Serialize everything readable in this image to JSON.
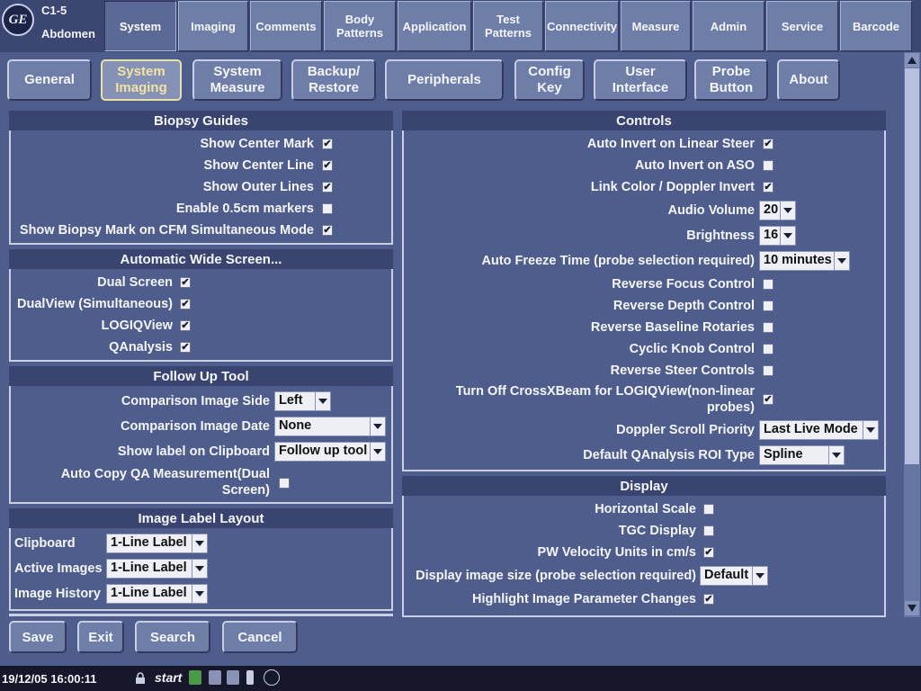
{
  "header": {
    "probe": "C1-5",
    "application": "Abdomen",
    "tabs": [
      {
        "label": "System"
      },
      {
        "label": "Imaging"
      },
      {
        "label": "Comments"
      },
      {
        "label": "Body\nPatterns"
      },
      {
        "label": "Application"
      },
      {
        "label": "Test\nPatterns"
      },
      {
        "label": "Connectivity"
      },
      {
        "label": "Measure"
      },
      {
        "label": "Admin"
      },
      {
        "label": "Service"
      },
      {
        "label": "Barcode"
      }
    ],
    "active_tab": "System"
  },
  "subtabs": [
    {
      "label": "General"
    },
    {
      "label": "System\nImaging"
    },
    {
      "label": "System\nMeasure"
    },
    {
      "label": "Backup/\nRestore"
    },
    {
      "label": "Peripherals"
    },
    {
      "label": "Config\nKey"
    },
    {
      "label": "User\nInterface"
    },
    {
      "label": "Probe\nButton"
    },
    {
      "label": "About"
    }
  ],
  "active_subtab": "System\nImaging",
  "biopsy": {
    "title": "Biopsy Guides",
    "items": [
      {
        "label": "Show Center Mark",
        "checked": true
      },
      {
        "label": "Show Center Line",
        "checked": true
      },
      {
        "label": "Show Outer Lines",
        "checked": true
      },
      {
        "label": "Enable 0.5cm markers",
        "checked": false
      },
      {
        "label": "Show Biopsy Mark on CFM Simultaneous Mode",
        "checked": true
      }
    ]
  },
  "widescreen": {
    "title": "Automatic Wide Screen...",
    "items": [
      {
        "label": "Dual Screen",
        "checked": true
      },
      {
        "label": "DualView (Simultaneous)",
        "checked": true
      },
      {
        "label": "LOGIQView",
        "checked": true
      },
      {
        "label": "QAnalysis",
        "checked": true
      }
    ]
  },
  "followup": {
    "title": "Follow Up Tool",
    "side_label": "Comparison Image Side",
    "side_value": "Left",
    "date_label": "Comparison Image Date",
    "date_value": "None",
    "clipboard_label": "Show label on Clipboard",
    "clipboard_value": "Follow up tool",
    "autocopy_label": "Auto Copy QA Measurement(Dual\nScreen)",
    "autocopy_checked": false
  },
  "labellayout": {
    "title": "Image Label Layout",
    "items": [
      {
        "label": "Clipboard",
        "value": "1-Line Label"
      },
      {
        "label": "Active Images",
        "value": "1-Line Label"
      },
      {
        "label": "Image History",
        "value": "1-Line Label"
      }
    ]
  },
  "controls": {
    "title": "Controls",
    "auto_invert_linear": "Auto Invert on Linear Steer",
    "auto_invert_aso": "Auto Invert on ASO",
    "link_color": "Link Color / Doppler Invert",
    "audio_volume_label": "Audio Volume",
    "audio_volume_value": "20",
    "brightness_label": "Brightness",
    "brightness_value": "16",
    "freeze_label": "Auto Freeze Time (probe selection required)",
    "freeze_value": "10 minutes",
    "reverse_focus": "Reverse Focus Control",
    "reverse_depth": "Reverse Depth Control",
    "reverse_baseline": "Reverse Baseline Rotaries",
    "cyclic_knob": "Cyclic Knob Control",
    "reverse_steer": "Reverse Steer Controls",
    "crossxbeam": "Turn Off CrossXBeam for LOGIQView(non-linear\nprobes)",
    "doppler_scroll_label": "Doppler Scroll Priority",
    "doppler_scroll_value": "Last Live Mode",
    "roi_label": "Default QAnalysis ROI Type",
    "roi_value": "Spline",
    "checks": {
      "auto_invert_linear": true,
      "auto_invert_aso": false,
      "link_color": true,
      "reverse_focus": false,
      "reverse_depth": false,
      "reverse_baseline": false,
      "cyclic_knob": false,
      "reverse_steer": false,
      "crossxbeam": true
    }
  },
  "display": {
    "title": "Display",
    "hscale": "Horizontal Scale",
    "tgc": "TGC Display",
    "pwvel": "PW Velocity Units in cm/s",
    "imgsize_label": "Display image size (probe selection required)",
    "imgsize_value": "Default",
    "highlight": "Highlight Image Parameter Changes",
    "checks": {
      "hscale": false,
      "tgc": false,
      "pwvel": true,
      "highlight": true
    }
  },
  "buttons": {
    "save": "Save",
    "exit": "Exit",
    "search": "Search",
    "cancel": "Cancel"
  },
  "taskbar": {
    "datetime": "19/12/05 16:00:11",
    "start": "start"
  },
  "colors": {
    "background": "#4f5d8c",
    "panel_title": "#3a4470",
    "active_subtab_text": "#f1e4a2"
  }
}
